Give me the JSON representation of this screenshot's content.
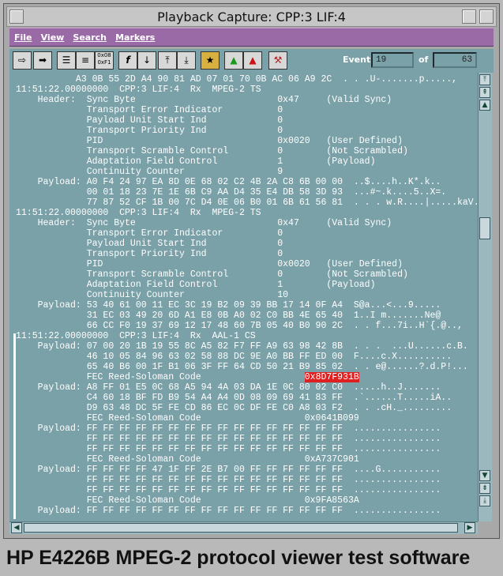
{
  "window": {
    "title": "Playback Capture: CPP:3 LIF:4"
  },
  "menu": [
    "File",
    "View",
    "Search",
    "Markers"
  ],
  "toolbar": {
    "icons": [
      "arrow-in-icon",
      "arrow-out-icon",
      "list-icon",
      "list2-icon",
      "bits-icon",
      "function-icon",
      "filter-down-icon",
      "collapse-icon",
      "expand-icon",
      "decode-icon",
      "flag-green-icon",
      "flag-red-icon",
      "tools-icon"
    ],
    "bits_label": "0x08\n0xF1",
    "event_label": "Event",
    "event_value": "19",
    "of_label": "of",
    "total_value": "63"
  },
  "log_lines": [
    "           A3 0B 55 2D A4 90 81 AD 07 01 70 0B AC 06 A9 2C  . . .U-.......p.....,",
    "11:51:22.00000000  CPP:3 LIF:4  Rx  MPEG-2 TS",
    "    Header:  Sync Byte                          0x47     (Valid Sync)",
    "             Transport Error Indicator          0",
    "             Payload Unit Start Ind             0",
    "             Transport Priority Ind             0",
    "             PID                                0x0020   (User Defined)",
    "             Transport Scramble Control         0        (Not Scrambled)",
    "             Adaptation Field Control           1        (Payload)",
    "             Continuity Counter                 9",
    "    Payload: A0 F4 24 97 EA 8D 0E 68 02 C2 4B 2A C8 6B 00 00  ..$....h..K*.k..",
    "             00 01 18 23 7E 1E 6B C9 AA D4 35 E4 DB 58 3D 93  ...#~.k....5..X=.",
    "             77 87 52 CF 1B 00 7C D4 0E 06 B0 01 6B 61 56 81  . . . w.R....|.....kaV.",
    "11:51:22.00000000  CPP:3 LIF:4  Rx  MPEG-2 TS",
    "    Header:  Sync Byte                          0x47     (Valid Sync)",
    "             Transport Error Indicator          0",
    "             Payload Unit Start Ind             0",
    "             Transport Priority Ind             0",
    "             PID                                0x0020   (User Defined)",
    "             Transport Scramble Control         0        (Not Scrambled)",
    "             Adaptation Field Control           1        (Payload)",
    "             Continuity Counter                 10",
    "    Payload: 53 40 61 00 11 EC 3C 19 B2 09 39 BB 17 14 0F A4  S@a...<...9.....",
    "             31 EC 03 49 20 6D A1 E8 0B A0 02 C0 BB 4E 65 40  1..I m.......Ne@",
    "             66 CC F0 19 37 69 12 17 48 60 7B 05 40 B0 90 2C  . . f...7i..H`{.@..,",
    "11:51:22.00000000  CPP:3 LIF:4  Rx  AAL-1 CS",
    "    Payload: 07 00 20 1B 19 55 8C A5 82 F7 FF A9 63 98 42 8B  . . .  ...U......c.B.",
    "             46 10 05 84 96 63 02 58 88 DC 9E A0 BB FF ED 00  F....c.X..........",
    "             65 40 B6 00 1F B1 06 3F FF 64 CD 50 21 B9 85 02  . . e@......?.d.P!...",
    "             FEC Reed-Soloman Code                   ",
    "    Payload: A8 FF 01 E5 0C 68 A5 94 4A 03 DA 1E 0C 80 02 C0  .....h..J.......",
    "             C4 60 18 BF FD B9 54 A4 A4 0D 08 09 69 41 83 FF  .`......T.....iA..",
    "             D9 63 48 DC 5F FE CD 86 EC 0C DF FE C0 A8 03 F2  . . .cH._.........",
    "             FEC Reed-Soloman Code                   0x0641B099",
    "    Payload: FF FF FF FF FF FF FF FF FF FF FF FF FF FF FF FF  ................",
    "             FF FF FF FF FF FF FF FF FF FF FF FF FF FF FF FF  ................",
    "             FF FF FF FF FF FF FF FF FF FF FF FF FF FF FF FF  ................",
    "             FEC Reed-Soloman Code                   0xA737C901",
    "    Payload: FF FF FF FF 47 1F FF 2E B7 00 FF FF FF FF FF FF  ....G...........",
    "             FF FF FF FF FF FF FF FF FF FF FF FF FF FF FF FF  ................",
    "             FF FF FF FF FF FF FF FF FF FF FF FF FF FF FF FF  ................",
    "             FEC Reed-Soloman Code                   0x9FA8563A",
    "    Payload: FF FF FF FF FF FF FF FF FF FF FF FF FF FF FF FF  ................"
  ],
  "highlighted_code": "0x8D7F931B",
  "caption": "HP E4226B MPEG-2 protocol viewer test software"
}
